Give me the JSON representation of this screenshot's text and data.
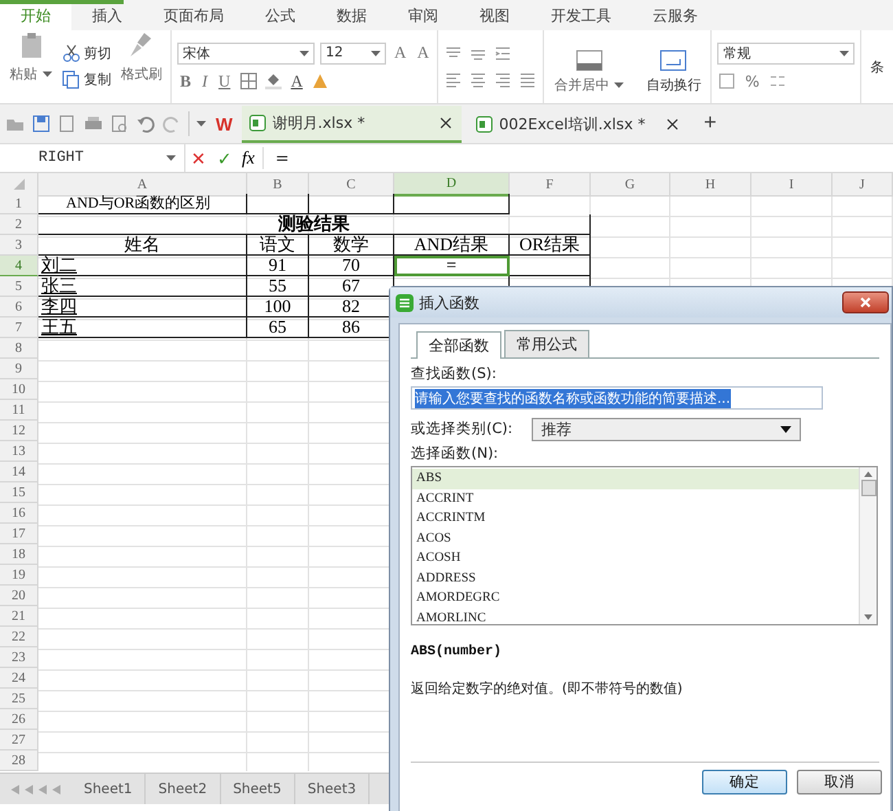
{
  "ribbon_tabs": [
    {
      "label": "开始",
      "selected": true
    },
    {
      "label": "插入",
      "selected": false
    },
    {
      "label": "页面布局",
      "selected": false
    },
    {
      "label": "公式",
      "selected": false
    },
    {
      "label": "数据",
      "selected": false
    },
    {
      "label": "审阅",
      "selected": false
    },
    {
      "label": "视图",
      "selected": false
    },
    {
      "label": "开发工具",
      "selected": false
    },
    {
      "label": "云服务",
      "selected": false
    }
  ],
  "ribbon": {
    "paste": "粘贴",
    "cut": "剪切",
    "copy": "复制",
    "format_painter": "格式刷",
    "font": "宋体",
    "font_size": "12",
    "grow_font": "A",
    "shrink_font": "A",
    "bold": "B",
    "italic": "I",
    "underline": "U",
    "font_color": "A",
    "merge": "合并居中",
    "wrap": "自动换行",
    "number_format": "常规",
    "percent": "%",
    "cut_off_label": "条"
  },
  "toolbar": {
    "app_logo": "W"
  },
  "doc_tabs": [
    {
      "title": "谢明月.xlsx *",
      "selected": true
    },
    {
      "title": "002Excel培训.xlsx *",
      "selected": false
    }
  ],
  "new_tab": "+",
  "formula_bar": {
    "name_box": "RIGHT",
    "cancel": "✕",
    "confirm": "✓",
    "fx": "fx",
    "formula": "="
  },
  "columns": [
    {
      "label": "A",
      "selected": false
    },
    {
      "label": "B",
      "selected": false
    },
    {
      "label": "C",
      "selected": false
    },
    {
      "label": "D",
      "selected": true
    },
    {
      "label": "F",
      "selected": false
    },
    {
      "label": "G",
      "selected": false
    },
    {
      "label": "H",
      "selected": false
    },
    {
      "label": "I",
      "selected": false
    },
    {
      "label": "J",
      "selected": false
    }
  ],
  "rows": [
    {
      "number": "1",
      "selected": false,
      "cells": [
        {
          "kind": "title",
          "text": "AND与OR函数的区别",
          "underlined": false,
          "active": false
        }
      ]
    },
    {
      "number": "2",
      "selected": false,
      "kind": "merged",
      "cells": [
        {
          "kind": "heading",
          "text": "测验结果",
          "underlined": false,
          "active": false
        }
      ]
    },
    {
      "number": "3",
      "selected": false,
      "cells": [
        {
          "kind": "heading",
          "text": "姓名",
          "underlined": false,
          "active": false
        },
        {
          "kind": "heading",
          "text": "语文",
          "underlined": false,
          "active": false
        },
        {
          "kind": "heading",
          "text": "数学",
          "underlined": false,
          "active": false
        },
        {
          "kind": "heading",
          "text": "AND结果",
          "underlined": false,
          "active": false
        },
        {
          "kind": "heading",
          "text": "OR结果",
          "underlined": false,
          "active": false
        }
      ]
    },
    {
      "number": "4",
      "selected": true,
      "cells": [
        {
          "kind": "name",
          "text": "刘二",
          "underlined": true,
          "active": false
        },
        {
          "kind": "number",
          "text": "91",
          "underlined": false,
          "active": false
        },
        {
          "kind": "number",
          "text": "70",
          "underlined": false,
          "active": false
        },
        {
          "kind": "number",
          "text": "=",
          "underlined": false,
          "active": true
        }
      ]
    },
    {
      "number": "5",
      "selected": false,
      "cells": [
        {
          "kind": "name",
          "text": "张三",
          "underlined": true,
          "active": false
        },
        {
          "kind": "number",
          "text": "55",
          "underlined": false,
          "active": false
        },
        {
          "kind": "number",
          "text": "67",
          "underlined": false,
          "active": false
        }
      ]
    },
    {
      "number": "6",
      "selected": false,
      "cells": [
        {
          "kind": "name",
          "text": "李四",
          "underlined": true,
          "active": false
        },
        {
          "kind": "number",
          "text": "100",
          "underlined": false,
          "active": false
        },
        {
          "kind": "number",
          "text": "82",
          "underlined": false,
          "active": false
        }
      ]
    },
    {
      "number": "7",
      "selected": false,
      "cells": [
        {
          "kind": "name",
          "text": "王五",
          "underlined": true,
          "active": false
        },
        {
          "kind": "number",
          "text": "65",
          "underlined": false,
          "active": false
        },
        {
          "kind": "number",
          "text": "86",
          "underlined": false,
          "active": false
        }
      ]
    },
    {
      "number": "8",
      "selected": false,
      "cells": []
    },
    {
      "number": "9",
      "selected": false,
      "cells": []
    },
    {
      "number": "10",
      "selected": false,
      "cells": []
    },
    {
      "number": "11",
      "selected": false,
      "cells": []
    },
    {
      "number": "12",
      "selected": false,
      "cells": []
    },
    {
      "number": "13",
      "selected": false,
      "cells": []
    },
    {
      "number": "14",
      "selected": false,
      "cells": []
    },
    {
      "number": "15",
      "selected": false,
      "cells": []
    },
    {
      "number": "16",
      "selected": false,
      "cells": []
    },
    {
      "number": "17",
      "selected": false,
      "cells": []
    },
    {
      "number": "18",
      "selected": false,
      "cells": []
    },
    {
      "number": "19",
      "selected": false,
      "cells": []
    },
    {
      "number": "20",
      "selected": false,
      "cells": []
    },
    {
      "number": "21",
      "selected": false,
      "cells": []
    },
    {
      "number": "22",
      "selected": false,
      "cells": []
    },
    {
      "number": "23",
      "selected": false,
      "cells": []
    },
    {
      "number": "24",
      "selected": false,
      "cells": []
    },
    {
      "number": "25",
      "selected": false,
      "cells": []
    },
    {
      "number": "26",
      "selected": false,
      "cells": []
    },
    {
      "number": "27",
      "selected": false,
      "cells": []
    },
    {
      "number": "28",
      "selected": false,
      "cells": []
    }
  ],
  "sheet_tabs": [
    {
      "label": "Sheet1",
      "selected": false
    },
    {
      "label": "Sheet2",
      "selected": false
    },
    {
      "label": "Sheet5",
      "selected": false
    },
    {
      "label": "Sheet3",
      "selected": false
    }
  ],
  "dialog": {
    "title": "插入函数",
    "tabs": [
      {
        "label": "全部函数",
        "selected": true
      },
      {
        "label": "常用公式",
        "selected": false
      }
    ],
    "search": {
      "label": "查找函数(S):",
      "value": "请输入您要查找的函数名称或函数功能的简要描述...",
      "selected": true
    },
    "category": {
      "label": "或选择类别(C):",
      "value": "推荐"
    },
    "list_label": "选择函数(N):",
    "functions": [
      {
        "name": "ABS",
        "selected": true
      },
      {
        "name": "ACCRINT",
        "selected": false
      },
      {
        "name": "ACCRINTM",
        "selected": false
      },
      {
        "name": "ACOS",
        "selected": false
      },
      {
        "name": "ACOSH",
        "selected": false
      },
      {
        "name": "ADDRESS",
        "selected": false
      },
      {
        "name": "AMORDEGRC",
        "selected": false
      },
      {
        "name": "AMORLINC",
        "selected": false
      }
    ],
    "signature": "ABS(number)",
    "description": "返回给定数字的绝对值。(即不带符号的数值)",
    "buttons": [
      {
        "label": "确定",
        "kind": "primary"
      },
      {
        "label": "取消",
        "kind": "secondary"
      }
    ]
  }
}
